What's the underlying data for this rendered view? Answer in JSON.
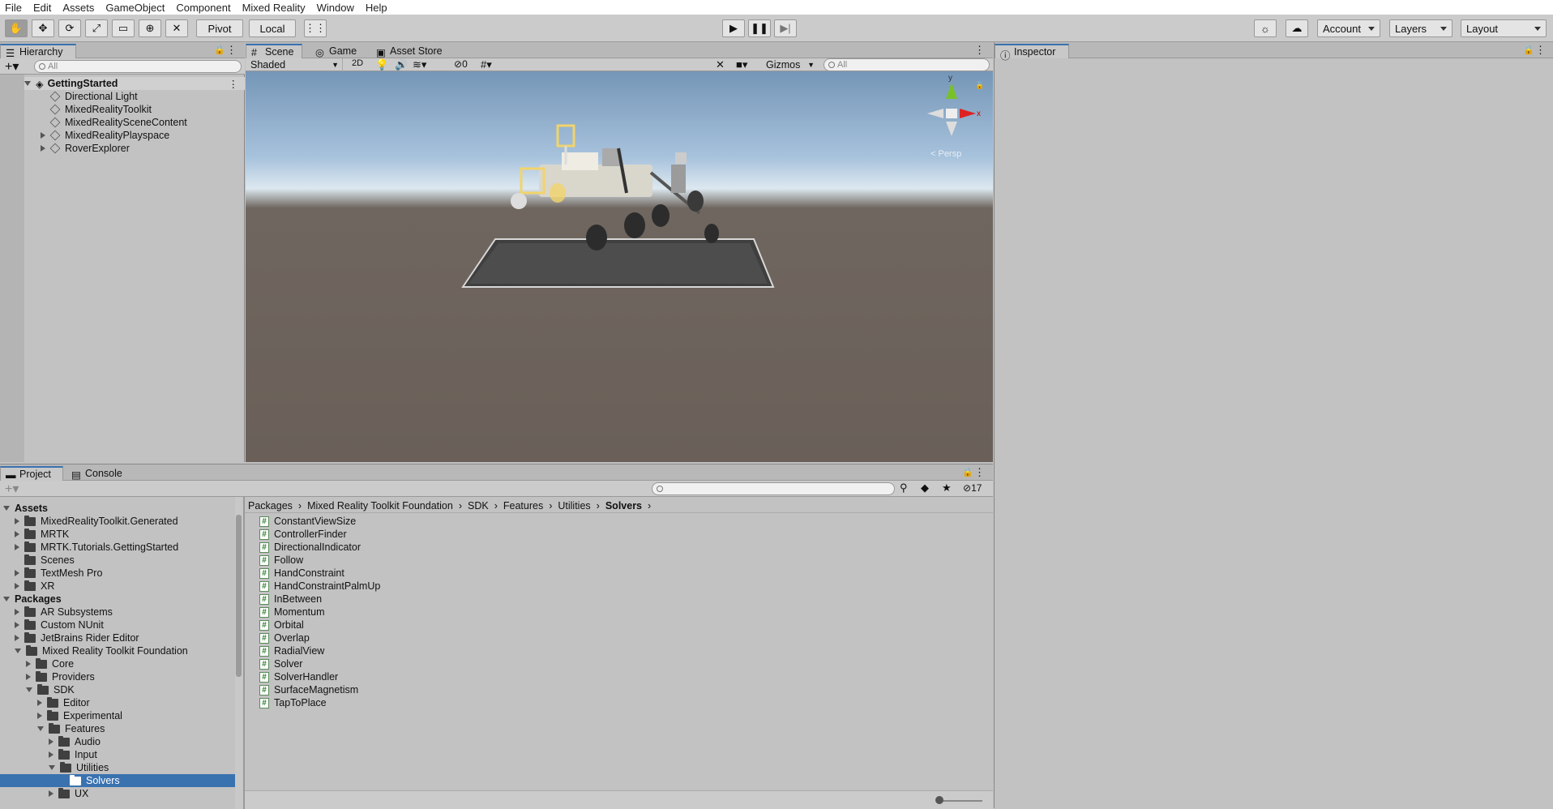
{
  "menu": [
    "File",
    "Edit",
    "Assets",
    "GameObject",
    "Component",
    "Mixed Reality",
    "Window",
    "Help"
  ],
  "toolbar": {
    "pivot": "Pivot",
    "local": "Local",
    "account": "Account",
    "layers": "Layers",
    "layout": "Layout"
  },
  "hierarchy": {
    "tab": "Hierarchy",
    "search_placeholder": "All",
    "scene": "GettingStarted",
    "items": [
      "Directional Light",
      "MixedRealityToolkit",
      "MixedRealitySceneContent",
      "MixedRealityPlayspace",
      "RoverExplorer"
    ]
  },
  "scene_tabs": [
    "Scene",
    "Game",
    "Asset Store"
  ],
  "scene_bar": {
    "shading": "Shaded",
    "mode2d": "2D",
    "hidden_count": "0",
    "gizmos": "Gizmos",
    "search_placeholder": "All"
  },
  "gizmo": {
    "y": "y",
    "x": "x",
    "persp": "< Persp"
  },
  "inspector": {
    "tab": "Inspector"
  },
  "bottom_tabs": [
    "Project",
    "Console"
  ],
  "project_count": "17",
  "project_tree": [
    {
      "label": "Assets",
      "level": 0,
      "bold": true,
      "open": true
    },
    {
      "label": "MixedRealityToolkit.Generated",
      "level": 1
    },
    {
      "label": "MRTK",
      "level": 1
    },
    {
      "label": "MRTK.Tutorials.GettingStarted",
      "level": 1
    },
    {
      "label": "Scenes",
      "level": 1,
      "leaf": true
    },
    {
      "label": "TextMesh Pro",
      "level": 1
    },
    {
      "label": "XR",
      "level": 1
    },
    {
      "label": "Packages",
      "level": 0,
      "bold": true,
      "open": true
    },
    {
      "label": "AR Subsystems",
      "level": 1
    },
    {
      "label": "Custom NUnit",
      "level": 1
    },
    {
      "label": "JetBrains Rider Editor",
      "level": 1
    },
    {
      "label": "Mixed Reality Toolkit Foundation",
      "level": 1,
      "open": true
    },
    {
      "label": "Core",
      "level": 2
    },
    {
      "label": "Providers",
      "level": 2
    },
    {
      "label": "SDK",
      "level": 2,
      "open": true
    },
    {
      "label": "Editor",
      "level": 3
    },
    {
      "label": "Experimental",
      "level": 3
    },
    {
      "label": "Features",
      "level": 3,
      "open": true
    },
    {
      "label": "Audio",
      "level": 4
    },
    {
      "label": "Input",
      "level": 4
    },
    {
      "label": "Utilities",
      "level": 4,
      "open": true
    },
    {
      "label": "Solvers",
      "level": 5,
      "leaf": true,
      "selected": true
    },
    {
      "label": "UX",
      "level": 4
    }
  ],
  "breadcrumb": [
    "Packages",
    "Mixed Reality Toolkit Foundation",
    "SDK",
    "Features",
    "Utilities",
    "Solvers"
  ],
  "files": [
    "ConstantViewSize",
    "ControllerFinder",
    "DirectionalIndicator",
    "Follow",
    "HandConstraint",
    "HandConstraintPalmUp",
    "InBetween",
    "Momentum",
    "Orbital",
    "Overlap",
    "RadialView",
    "Solver",
    "SolverHandler",
    "SurfaceMagnetism",
    "TapToPlace"
  ]
}
